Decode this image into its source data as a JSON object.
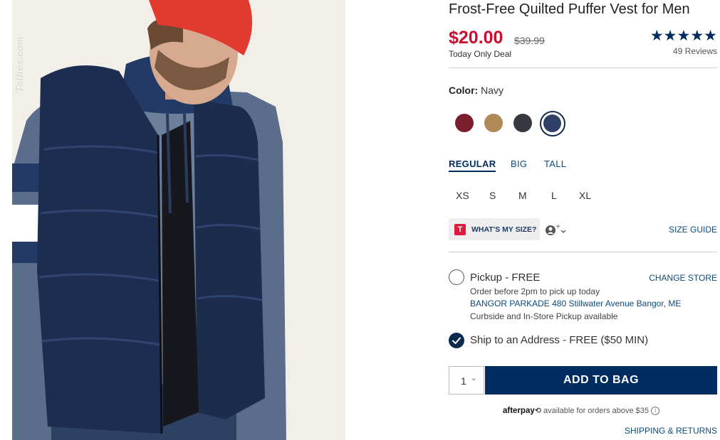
{
  "product": {
    "title": "Frost-Free Quilted Puffer Vest for Men",
    "price": "$20.00",
    "original_price": "$39.99",
    "deal_note": "Today Only Deal",
    "stars": "★★★★★",
    "rating": 5,
    "reviews": "49 Reviews"
  },
  "photo": {
    "watermark": "Tallies.com",
    "icon": "model-wearing-vest"
  },
  "color": {
    "label": "Color:",
    "selected": "Navy",
    "swatches": [
      "#7b1e2e",
      "#b08a58",
      "#36393f",
      "#2f3f66"
    ],
    "selected_index": 3
  },
  "fit": {
    "tabs": [
      "REGULAR",
      "BIG",
      "TALL"
    ],
    "active": "REGULAR"
  },
  "sizes": [
    "XS",
    "S",
    "M",
    "L",
    "XL"
  ],
  "size_tools": {
    "badge": "T",
    "whats_my_size": "WHAT'S MY SIZE?",
    "size_guide": "SIZE GUIDE"
  },
  "fulfillment": {
    "pickup_label": "Pickup - FREE",
    "change_store": "CHANGE STORE",
    "pickup_note": "Order before 2pm to pick up today",
    "store": "BANGOR PARKADE 480 Stillwater Avenue  Bangor, ME",
    "pickup_availability": "Curbside and In-Store Pickup available",
    "ship_label": "Ship to an Address - FREE ($50 MIN)",
    "selected": "ship"
  },
  "purchase": {
    "quantity": "1",
    "add_to_bag": "ADD TO BAG",
    "afterpay_brand": "afterpay",
    "afterpay_text": "available for orders above $35",
    "shipping_returns": "SHIPPING & RETURNS"
  },
  "colors": {
    "price_red": "#c8102e",
    "brand_navy": "#002d5f",
    "link_blue": "#0d4a7c"
  }
}
